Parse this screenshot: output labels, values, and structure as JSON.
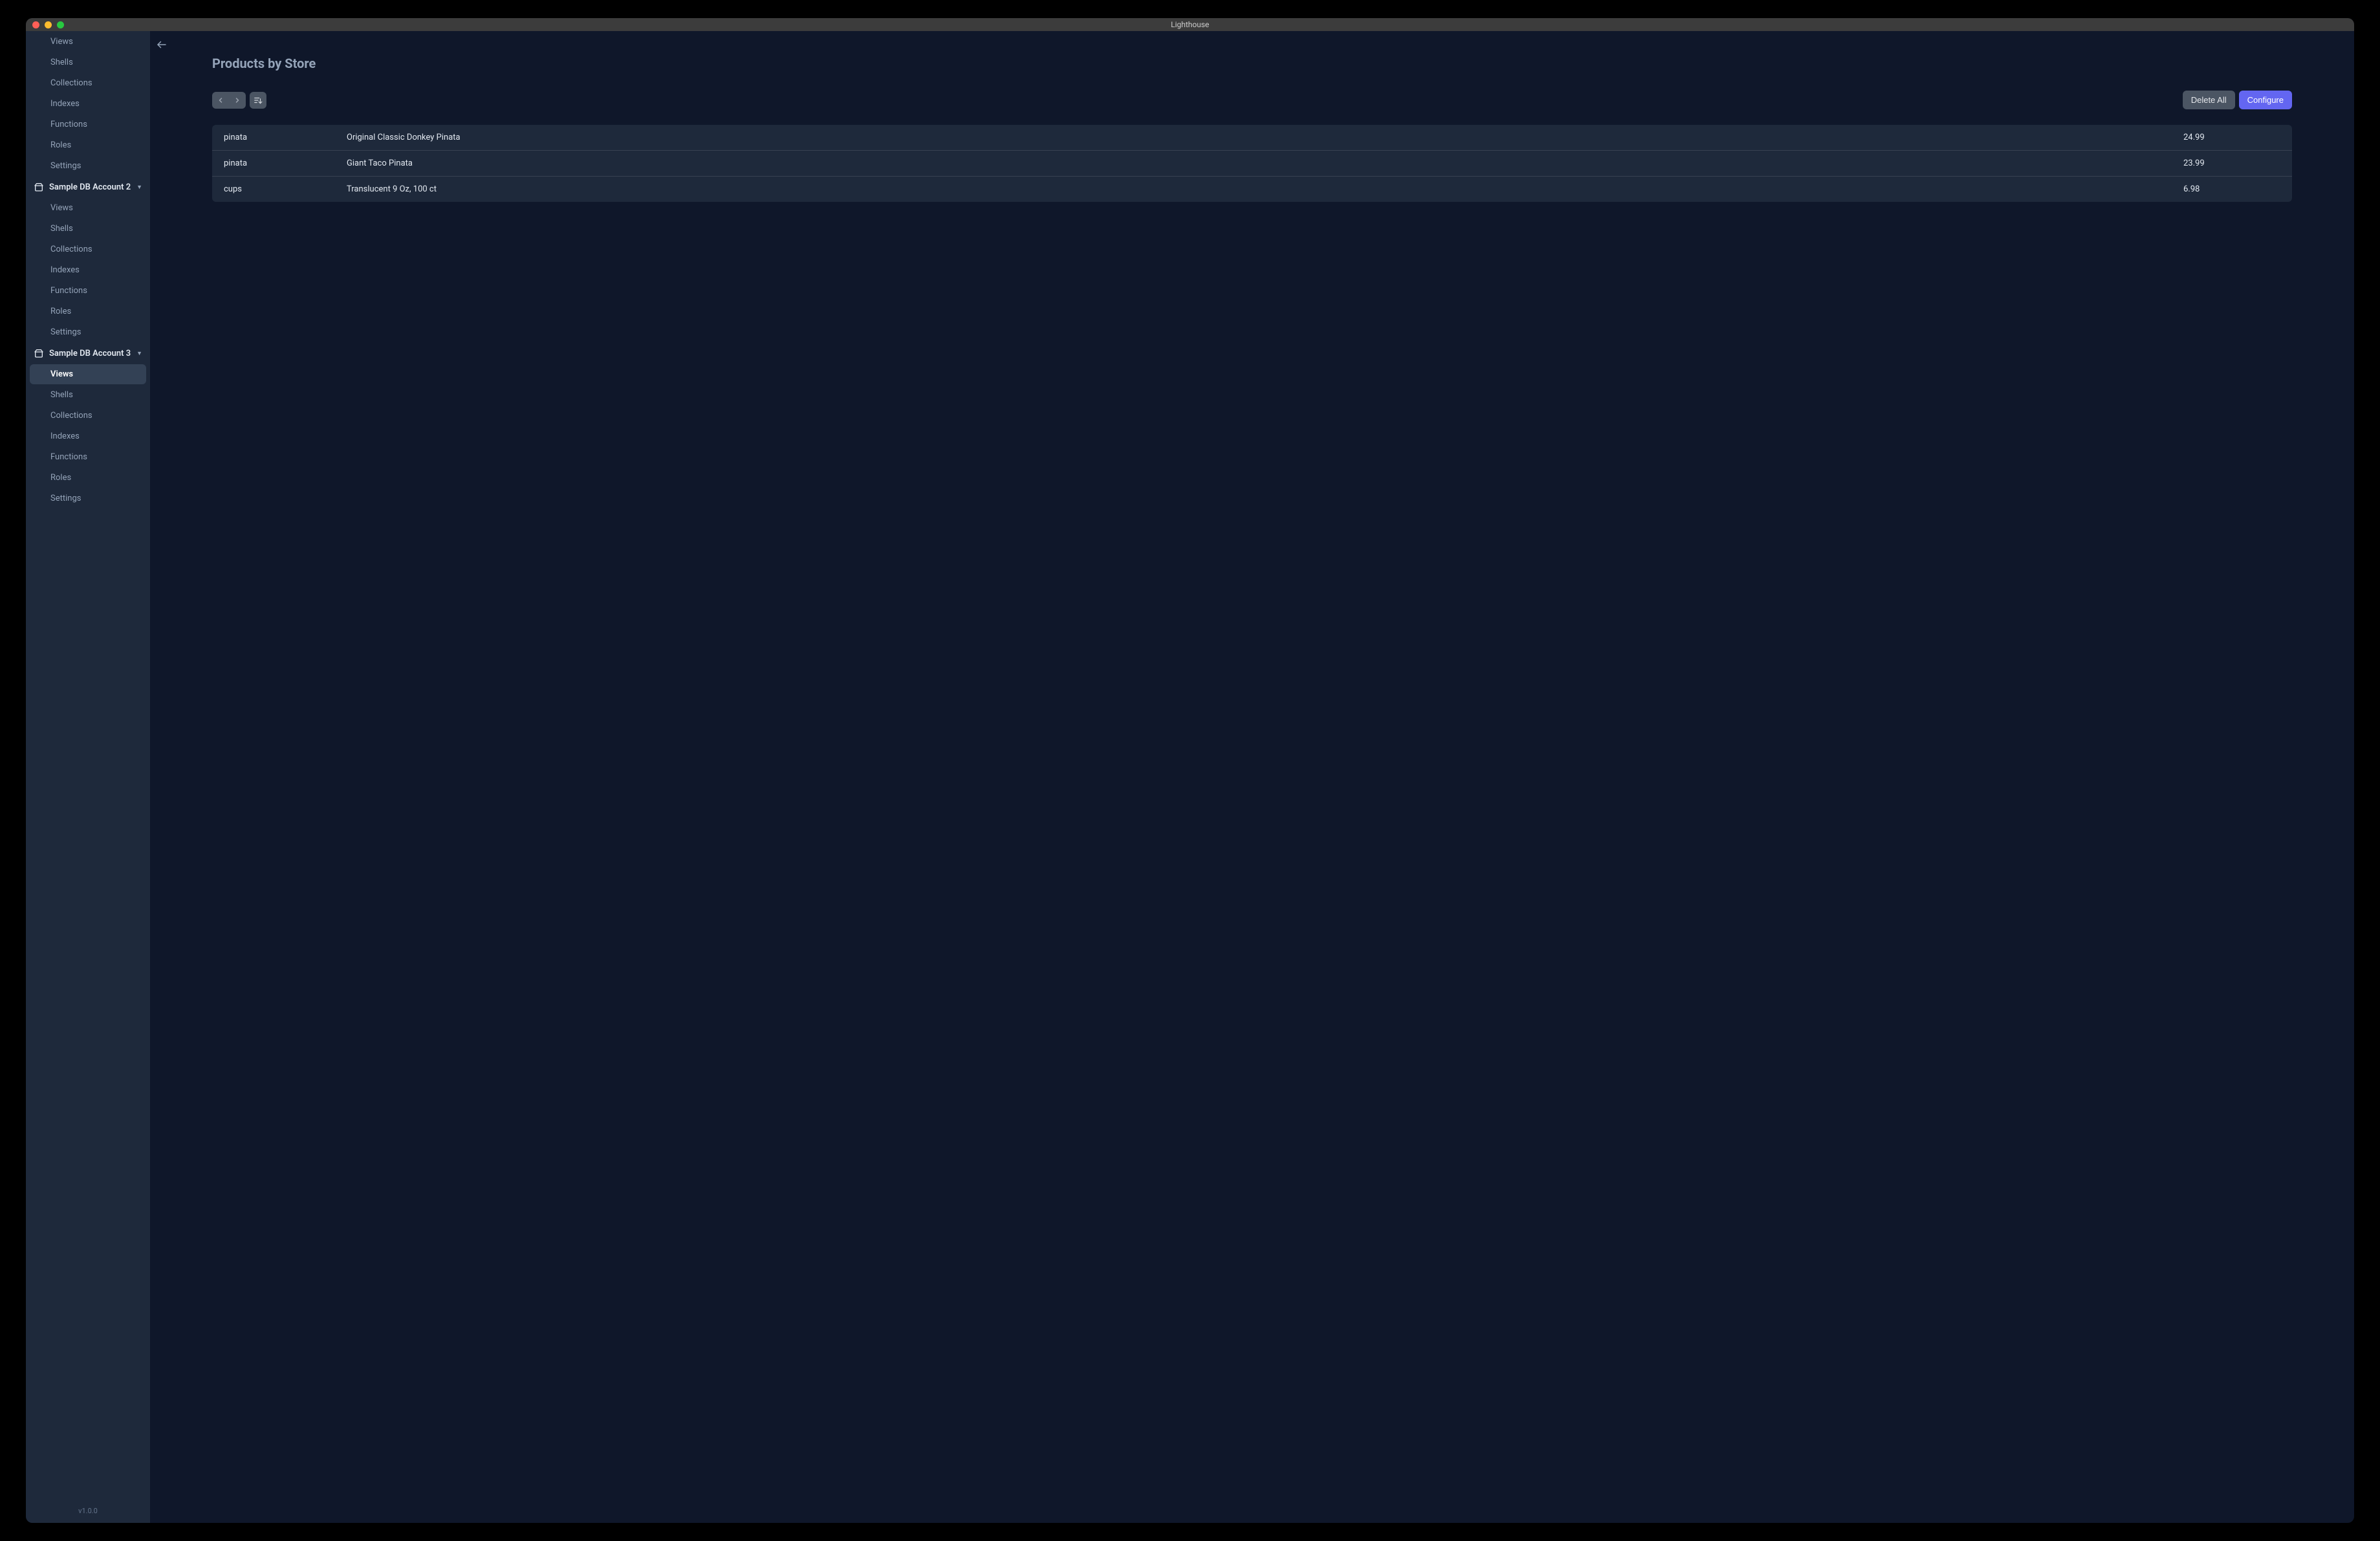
{
  "window": {
    "title": "Lighthouse"
  },
  "sidebar": {
    "child_labels": {
      "views": "Views",
      "shells": "Shells",
      "collections": "Collections",
      "indexes": "Indexes",
      "functions": "Functions",
      "roles": "Roles",
      "settings": "Settings"
    },
    "accounts": [
      {
        "name": "Sample DB Account 2"
      },
      {
        "name": "Sample DB Account 3"
      }
    ],
    "version": "v1.0.0"
  },
  "page": {
    "title": "Products by Store",
    "buttons": {
      "delete_all": "Delete All",
      "configure": "Configure"
    },
    "rows": [
      {
        "category": "pinata",
        "name": "Original Classic Donkey Pinata",
        "price": "24.99"
      },
      {
        "category": "pinata",
        "name": "Giant Taco Pinata",
        "price": "23.99"
      },
      {
        "category": "cups",
        "name": "Translucent 9 Oz, 100 ct",
        "price": "6.98"
      }
    ]
  }
}
